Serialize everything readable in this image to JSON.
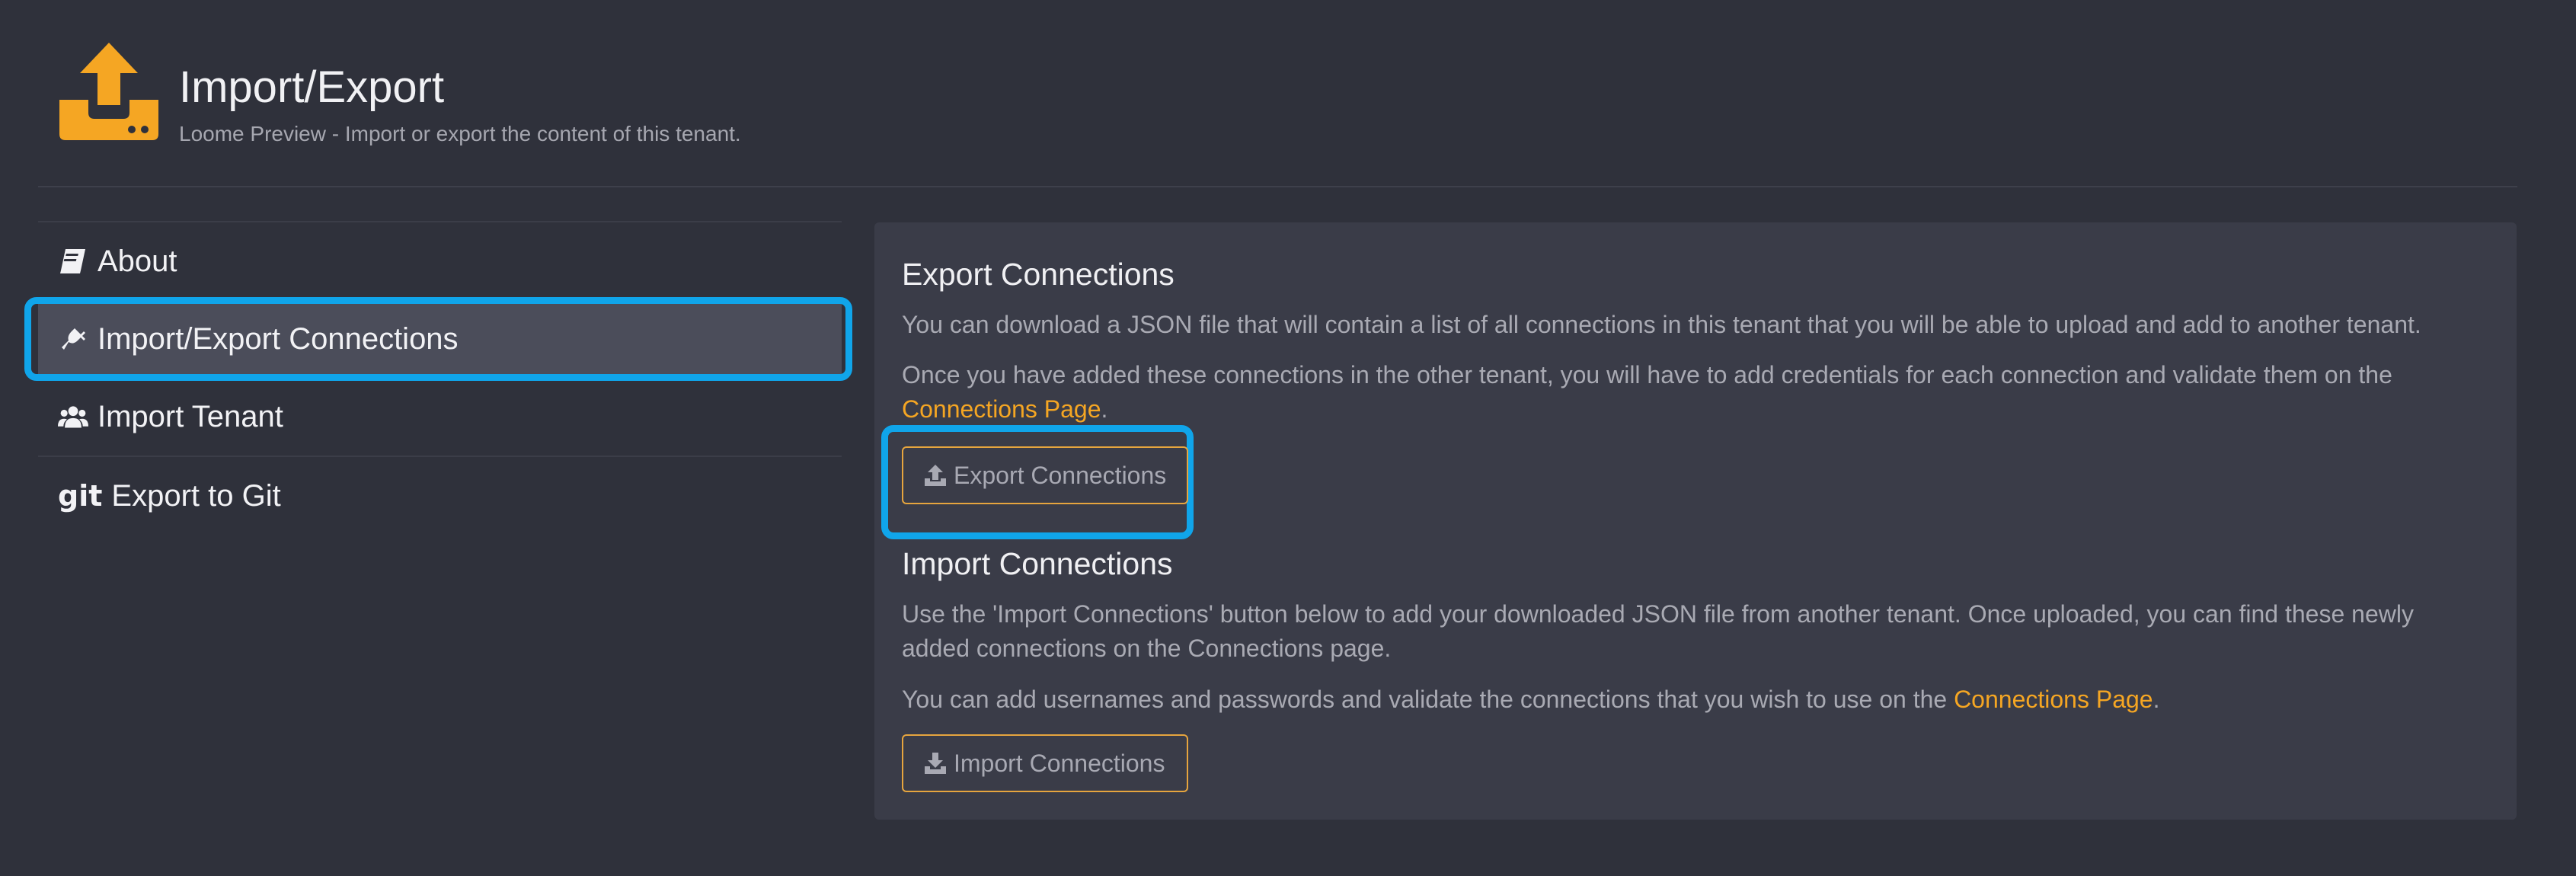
{
  "header": {
    "title": "Import/Export",
    "subtitle": "Loome Preview - Import or export the content of this tenant."
  },
  "sidebar": {
    "items": [
      {
        "label": "About",
        "icon": "book-icon"
      },
      {
        "label": "Import/Export Connections",
        "icon": "plug-icon",
        "active": true
      },
      {
        "label": "Import Tenant",
        "icon": "users-icon"
      },
      {
        "label": "Export to Git",
        "icon": "git-icon",
        "icon_text": "git"
      }
    ]
  },
  "export": {
    "heading": "Export Connections",
    "p1": "You can download a JSON file that will contain a list of all connections in this tenant that you will be able to upload and add to another tenant.",
    "p2_before": "Once you have added these connections in the other tenant, you will have to add credentials for each connection and validate them on the",
    "p2_link": "Connections Page",
    "p2_after": ".",
    "button": "Export Connections"
  },
  "import": {
    "heading": "Import Connections",
    "p1": "Use the 'Import Connections' button below to add your downloaded JSON file from another tenant. Once uploaded, you can find these newly added connections on the Connections page.",
    "p2_before": "You can add usernames and passwords and validate the connections that you wish to use on the ",
    "p2_link": "Connections Page",
    "p2_after": ".",
    "button": "Import Connections"
  },
  "colors": {
    "accent": "#f5a623",
    "highlight": "#10a5ea",
    "background": "#2f313b",
    "panel": "#3a3c48"
  }
}
